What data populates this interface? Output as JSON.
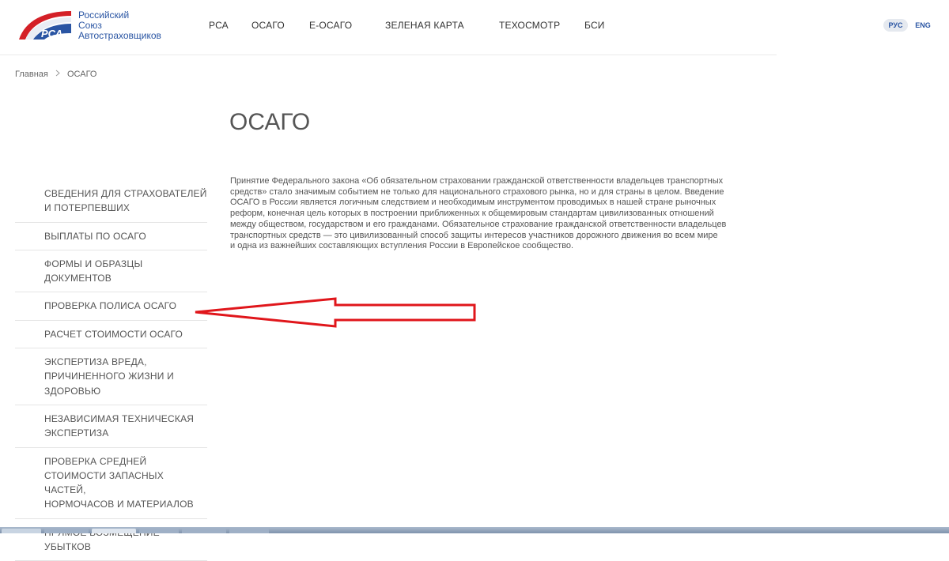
{
  "logo": {
    "mark": "РСА",
    "lines": [
      "Российский",
      "Союз",
      "Автостраховщиков"
    ]
  },
  "nav": [
    "РСА",
    "ОСАГО",
    "Е-ОСАГО",
    "ЗЕЛЕНАЯ КАРТА",
    "ТЕХОСМОТР",
    "БСИ"
  ],
  "languages": {
    "active": "РУС",
    "other": "ENG"
  },
  "breadcrumb": {
    "home": "Главная",
    "current": "ОСАГО"
  },
  "page": {
    "title": "ОСАГО",
    "intro_lines": [
      "Принятие Федерального закона «Об обязательном страховании гражданской ответственности владельцев транспортных",
      "средств» стало значимым событием не только для национального страхового рынка, но и для страны в целом. Введение",
      "ОСАГО в России является логичным следствием и необходимым инструментом проводимых в нашей стране рыночных",
      "реформ, конечная цель которых в построении приближенных к общемировым стандартам цивилизованных отношений",
      "между обществом, государством и его гражданами. Обязательное страхование гражданской ответственности владельцев",
      "транспортных средств — это цивилизованный способ защиты интересов участников дорожного движения во всем мире",
      "и одна из важнейших составляющих вступления России в Европейское сообщество."
    ]
  },
  "sidebar": [
    {
      "lines": [
        "Сведения для страхователей",
        "и потерпевших"
      ]
    },
    {
      "lines": [
        "Выплаты по ОСАГО"
      ]
    },
    {
      "lines": [
        "Формы и образцы",
        "документов"
      ]
    },
    {
      "lines": [
        "Проверка полиса ОСАГО"
      ]
    },
    {
      "lines": [
        "Расчет стоимости ОСАГО"
      ]
    },
    {
      "lines": [
        "Экспертиза вреда,",
        "причиненного жизни и",
        "здоровью"
      ]
    },
    {
      "lines": [
        "Независимая техническая",
        "экспертиза"
      ]
    },
    {
      "lines": [
        "Проверка средней",
        "стоимости запасных частей,",
        "нормочасов и материалов"
      ]
    },
    {
      "lines": [
        "Прямое возмещение убытков"
      ]
    }
  ],
  "annotation": {
    "color": "#e0161b",
    "points_to": "Проверка полиса ОСАГО"
  },
  "colors": {
    "brand_blue": "#2a55a3",
    "brand_red": "#d42027",
    "text": "#555555"
  }
}
